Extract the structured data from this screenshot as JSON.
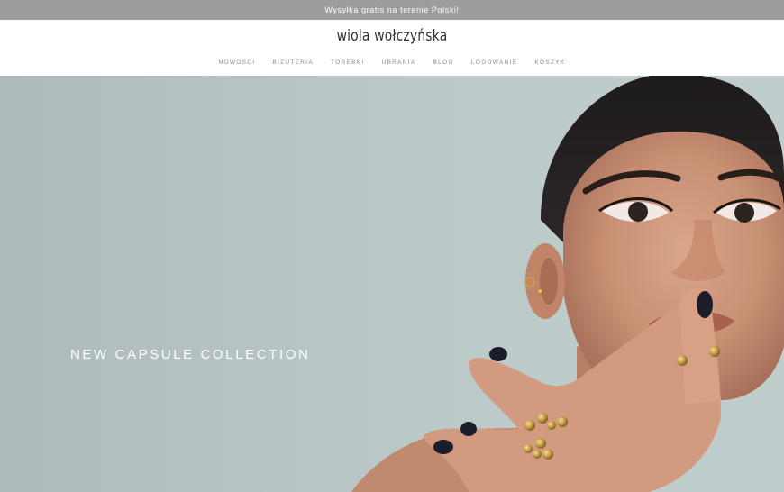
{
  "announcement": {
    "text": "Wysyłka gratis na terenie Polski!"
  },
  "header": {
    "logo": "wiola wołczyńska",
    "nav": [
      {
        "label": "NOWOŚCI"
      },
      {
        "label": "BIZUTERIA"
      },
      {
        "label": "TOREBKI"
      },
      {
        "label": "UBRANIA"
      },
      {
        "label": "BLOG"
      },
      {
        "label": "LOGOWANIE"
      },
      {
        "label": "KOSZYK"
      }
    ]
  },
  "hero": {
    "title": "NEW CAPSULE COLLECTION"
  },
  "colors": {
    "announcement_bg": "#9c9c9c",
    "hero_bg": "#b9c6c7",
    "nav_text": "#8a8a8a"
  }
}
